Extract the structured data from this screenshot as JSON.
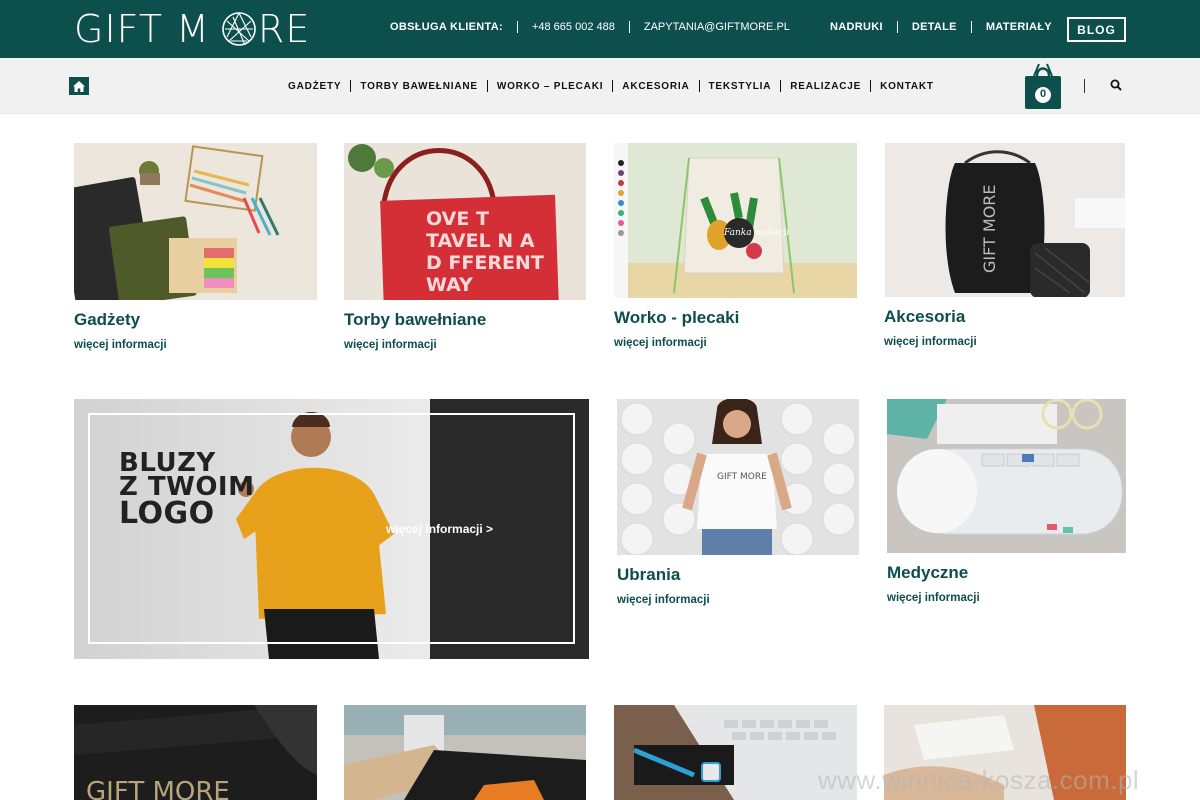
{
  "brand": {
    "logo_text_left": "GIFT M",
    "logo_text_right": "RE"
  },
  "topbar": {
    "contact_label": "OBSŁUGA KLIENTA:",
    "phone": "+48 665 002 488",
    "email": "ZAPYTANIA@GIFTMORE.PL",
    "links": [
      "NADRUKI",
      "DETALE",
      "MATERIAŁY"
    ],
    "blog_label": "BLOG"
  },
  "nav": {
    "items": [
      "GADŻETY",
      "TORBY BAWEŁNIANE",
      "WORKO – PLECAKI",
      "AKCESORIA",
      "TEKSTYLIA",
      "REALIZACJE",
      "KONTAKT"
    ],
    "cart_count": "0"
  },
  "products": [
    {
      "name": "Gadżety",
      "more": "więcej informacji"
    },
    {
      "name": "Torby bawełniane",
      "more": "więcej informacji"
    },
    {
      "name": "Worko - plecaki",
      "more": "więcej informacji"
    },
    {
      "name": "Akcesoria",
      "more": "więcej informacji"
    },
    {
      "name": "Ubrania",
      "more": "więcej informacji"
    },
    {
      "name": "Medyczne",
      "more": "więcej informacji"
    }
  ],
  "banner": {
    "headline_line1": "BLUZY",
    "headline_line2": "Z TWOIM",
    "headline_line3": "LOGO",
    "cta": "więcej informacji >"
  },
  "image_texts": {
    "bag_line1": "OVE T",
    "bag_line2": "TAVEL N A",
    "bag_line3": "D FFERENT",
    "bag_line4": "WAY",
    "pouch_logo": "GIFT MORE",
    "shirt_logo": "GIFT MORE",
    "notebook_logo": "GIFT MORE",
    "backpack_badge": "Fanka wakacji"
  },
  "watermark": "www.winnica-kosza.com.pl",
  "colors": {
    "primary": "#0c4f4d",
    "banner_dark": "#2a2a2a",
    "banner_light": "#d6d6d6"
  }
}
